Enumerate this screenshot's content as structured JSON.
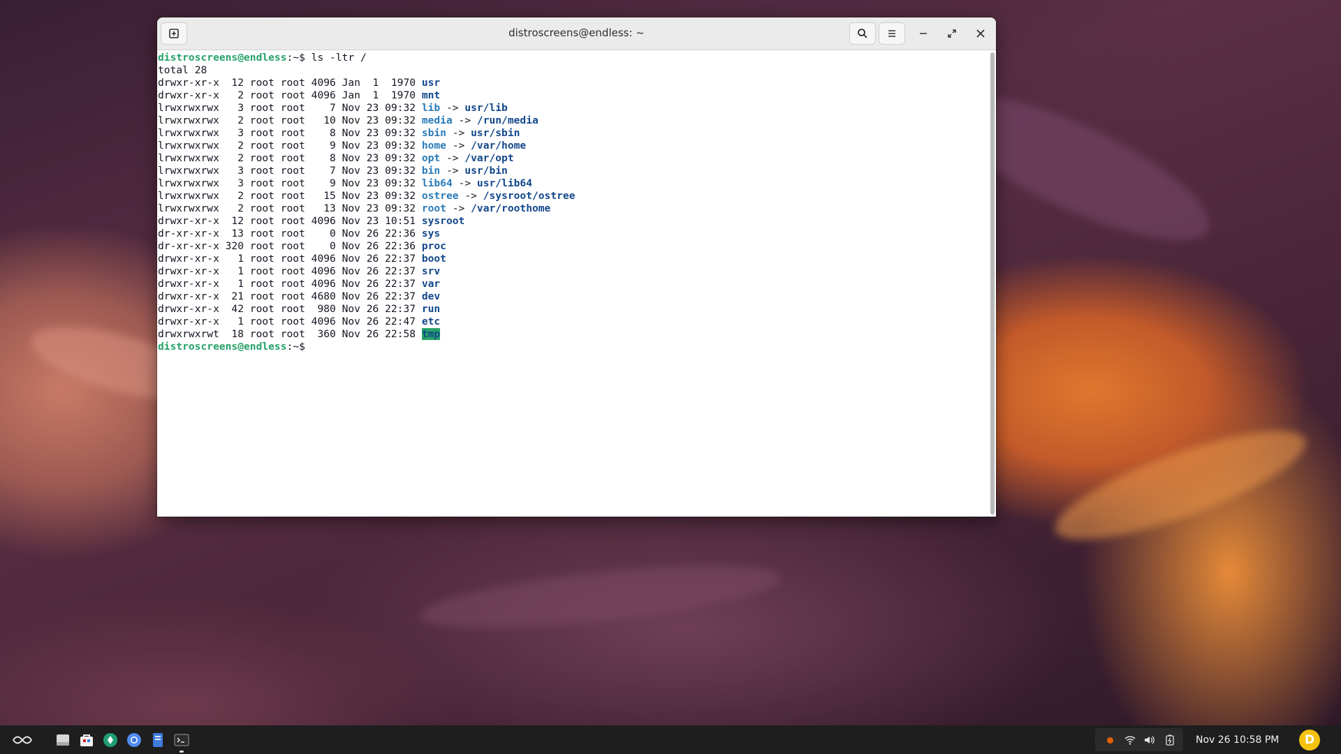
{
  "window": {
    "title": "distroscreens@endless: ~"
  },
  "terminal": {
    "lines": [
      [
        {
          "t": "distroscreens@endless",
          "c": "prompt"
        },
        {
          "t": ":~$ ls -ltr /",
          "c": ""
        }
      ],
      [
        {
          "t": "total 28",
          "c": ""
        }
      ],
      [
        {
          "t": "drwxr-xr-x  12 root root 4096 Jan  1  1970 ",
          "c": ""
        },
        {
          "t": "usr",
          "c": "dir"
        }
      ],
      [
        {
          "t": "drwxr-xr-x   2 root root 4096 Jan  1  1970 ",
          "c": ""
        },
        {
          "t": "mnt",
          "c": "dir"
        }
      ],
      [
        {
          "t": "lrwxrwxrwx   3 root root    7 Nov 23 09:32 ",
          "c": ""
        },
        {
          "t": "lib",
          "c": "link"
        },
        {
          "t": " -> ",
          "c": ""
        },
        {
          "t": "usr/lib",
          "c": "dir"
        }
      ],
      [
        {
          "t": "lrwxrwxrwx   2 root root   10 Nov 23 09:32 ",
          "c": ""
        },
        {
          "t": "media",
          "c": "link"
        },
        {
          "t": " -> ",
          "c": ""
        },
        {
          "t": "/run/media",
          "c": "dir"
        }
      ],
      [
        {
          "t": "lrwxrwxrwx   3 root root    8 Nov 23 09:32 ",
          "c": ""
        },
        {
          "t": "sbin",
          "c": "link"
        },
        {
          "t": " -> ",
          "c": ""
        },
        {
          "t": "usr/sbin",
          "c": "dir"
        }
      ],
      [
        {
          "t": "lrwxrwxrwx   2 root root    9 Nov 23 09:32 ",
          "c": ""
        },
        {
          "t": "home",
          "c": "link"
        },
        {
          "t": " -> ",
          "c": ""
        },
        {
          "t": "/var/home",
          "c": "dir"
        }
      ],
      [
        {
          "t": "lrwxrwxrwx   2 root root    8 Nov 23 09:32 ",
          "c": ""
        },
        {
          "t": "opt",
          "c": "link"
        },
        {
          "t": " -> ",
          "c": ""
        },
        {
          "t": "/var/opt",
          "c": "dir"
        }
      ],
      [
        {
          "t": "lrwxrwxrwx   3 root root    7 Nov 23 09:32 ",
          "c": ""
        },
        {
          "t": "bin",
          "c": "link"
        },
        {
          "t": " -> ",
          "c": ""
        },
        {
          "t": "usr/bin",
          "c": "dir"
        }
      ],
      [
        {
          "t": "lrwxrwxrwx   3 root root    9 Nov 23 09:32 ",
          "c": ""
        },
        {
          "t": "lib64",
          "c": "link"
        },
        {
          "t": " -> ",
          "c": ""
        },
        {
          "t": "usr/lib64",
          "c": "dir"
        }
      ],
      [
        {
          "t": "lrwxrwxrwx   2 root root   15 Nov 23 09:32 ",
          "c": ""
        },
        {
          "t": "ostree",
          "c": "link"
        },
        {
          "t": " -> ",
          "c": ""
        },
        {
          "t": "/sysroot/ostree",
          "c": "dir"
        }
      ],
      [
        {
          "t": "lrwxrwxrwx   2 root root   13 Nov 23 09:32 ",
          "c": ""
        },
        {
          "t": "root",
          "c": "link"
        },
        {
          "t": " -> ",
          "c": ""
        },
        {
          "t": "/var/roothome",
          "c": "dir"
        }
      ],
      [
        {
          "t": "drwxr-xr-x  12 root root 4096 Nov 23 10:51 ",
          "c": ""
        },
        {
          "t": "sysroot",
          "c": "dir"
        }
      ],
      [
        {
          "t": "dr-xr-xr-x  13 root root    0 Nov 26 22:36 ",
          "c": ""
        },
        {
          "t": "sys",
          "c": "dir"
        }
      ],
      [
        {
          "t": "dr-xr-xr-x 320 root root    0 Nov 26 22:36 ",
          "c": ""
        },
        {
          "t": "proc",
          "c": "dir"
        }
      ],
      [
        {
          "t": "drwxr-xr-x   1 root root 4096 Nov 26 22:37 ",
          "c": ""
        },
        {
          "t": "boot",
          "c": "dir"
        }
      ],
      [
        {
          "t": "drwxr-xr-x   1 root root 4096 Nov 26 22:37 ",
          "c": ""
        },
        {
          "t": "srv",
          "c": "dir"
        }
      ],
      [
        {
          "t": "drwxr-xr-x   1 root root 4096 Nov 26 22:37 ",
          "c": ""
        },
        {
          "t": "var",
          "c": "dir"
        }
      ],
      [
        {
          "t": "drwxr-xr-x  21 root root 4680 Nov 26 22:37 ",
          "c": ""
        },
        {
          "t": "dev",
          "c": "dir"
        }
      ],
      [
        {
          "t": "drwxr-xr-x  42 root root  980 Nov 26 22:37 ",
          "c": ""
        },
        {
          "t": "run",
          "c": "dir"
        }
      ],
      [
        {
          "t": "drwxr-xr-x   1 root root 4096 Nov 26 22:47 ",
          "c": ""
        },
        {
          "t": "etc",
          "c": "dir"
        }
      ],
      [
        {
          "t": "drwxrwxrwt  18 root root  360 Nov 26 22:58 ",
          "c": ""
        },
        {
          "t": "tmp",
          "c": "tmpdir"
        }
      ],
      [
        {
          "t": "distroscreens@endless",
          "c": "prompt"
        },
        {
          "t": ":~$ ",
          "c": ""
        }
      ]
    ]
  },
  "taskbar": {
    "apps": [
      {
        "name": "files-app-icon"
      },
      {
        "name": "app-center-icon"
      },
      {
        "name": "endless-key-icon"
      },
      {
        "name": "chromium-icon"
      },
      {
        "name": "text-editor-icon"
      },
      {
        "name": "terminal-icon"
      }
    ],
    "clock": "Nov 26  10:58 PM",
    "avatar_letter": "D"
  },
  "colors": {
    "prompt": "#26a269",
    "directory": "#12488b",
    "symlink": "#2a7bb8",
    "accent_avatar": "#f5c211"
  }
}
